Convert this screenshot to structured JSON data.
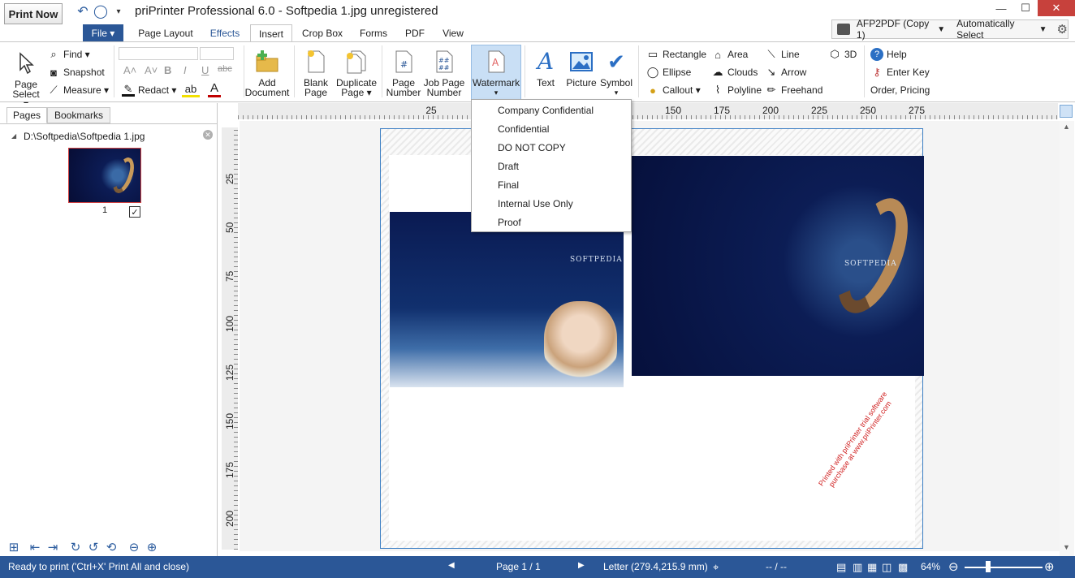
{
  "titlebar": {
    "print_now": "Print Now",
    "title": "priPrinter Professional 6.0 - Softpedia 1.jpg unregistered",
    "minimize": "—",
    "maximize": "☐",
    "close": "✕"
  },
  "tabs": {
    "file": "File ▾",
    "page_layout": "Page Layout",
    "effects": "Effects",
    "insert": "Insert",
    "crop_box": "Crop Box",
    "forms": "Forms",
    "pdf": "PDF",
    "view": "View"
  },
  "printer": {
    "name": "AFP2PDF (Copy 1)",
    "mode": "Automatically Select"
  },
  "ribbon": {
    "page_select": [
      "Page",
      "Select ▾"
    ],
    "find": "Find ▾",
    "snapshot": "Snapshot",
    "measure": "Measure ▾",
    "redact": "Redact ▾",
    "add_document": [
      "Add",
      "Document"
    ],
    "blank_page": [
      "Blank",
      "Page"
    ],
    "duplicate_page": [
      "Duplicate",
      "Page ▾"
    ],
    "page_number": [
      "Page",
      "Number"
    ],
    "job_page_number": [
      "Job Page",
      "Number"
    ],
    "watermark": "Watermark",
    "text": "Text",
    "picture": "Picture",
    "symbol": "Symbol",
    "rectangle": "Rectangle",
    "ellipse": "Ellipse",
    "callout": "Callout ▾",
    "area": "Area",
    "clouds": "Clouds",
    "polyline": "Polyline",
    "line": "Line",
    "arrow": "Arrow",
    "freehand": "Freehand",
    "three_d": "3D",
    "help": "Help",
    "enter_key": "Enter Key",
    "order_pricing": "Order, Pricing"
  },
  "left_panel": {
    "tab_pages": "Pages",
    "tab_bookmarks": "Bookmarks",
    "file_path": "D:\\Softpedia\\Softpedia 1.jpg",
    "thumb_number": "1"
  },
  "ruler": {
    "h": [
      "25",
      "150",
      "175",
      "200",
      "225",
      "250",
      "275"
    ],
    "v": [
      "25",
      "50",
      "75",
      "100",
      "125",
      "150",
      "175",
      "200"
    ]
  },
  "document": {
    "brand": "SOFTPEDIA",
    "trial_text": "Printed with priPrinter trial software purchase at www.priPrinter.com"
  },
  "watermark_menu": {
    "items": [
      "Company Confidential",
      "Confidential",
      "DO NOT COPY",
      "Draft",
      "Final",
      "Internal Use Only",
      "Proof"
    ]
  },
  "status": {
    "message": "Ready to print ('Ctrl+X' Print All and close)",
    "page": "Page 1 / 1",
    "paper": "Letter (279.4,215.9 mm)",
    "coords": "-- / --",
    "zoom": "64%"
  },
  "colors": {
    "accent": "#2b5797",
    "highlight": "#c9dff5",
    "trial_red": "#d02020"
  }
}
